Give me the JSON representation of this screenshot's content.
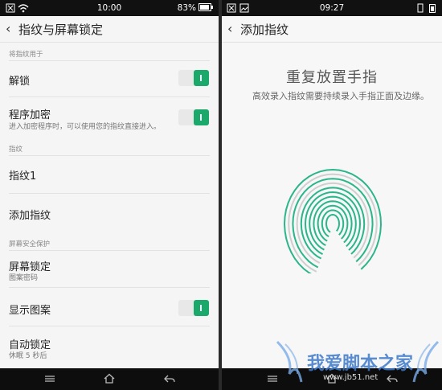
{
  "left": {
    "status": {
      "time": "10:00",
      "battery": "83%"
    },
    "header": {
      "back_icon": "‹",
      "title": "指纹与屏幕锁定"
    },
    "section_fingerprint_use": "将指纹用于",
    "unlock": {
      "label": "解锁",
      "enabled": true
    },
    "app_encrypt": {
      "label": "程序加密",
      "sub": "进入加密程序时，可以使用您的指纹直接进入。",
      "enabled": true
    },
    "section_fingerprint": "指纹",
    "fingerprint_1": {
      "label": "指纹1"
    },
    "add_fingerprint": {
      "label": "添加指纹"
    },
    "section_screen_security": "屏幕安全保护",
    "screen_lock": {
      "label": "屏幕锁定",
      "sub": "图案密码"
    },
    "show_pattern": {
      "label": "显示图案",
      "enabled": true
    },
    "auto_lock": {
      "label": "自动锁定",
      "sub": "休眠 5 秒后"
    }
  },
  "right": {
    "status": {
      "time": "09:27"
    },
    "header": {
      "back_icon": "‹",
      "title": "添加指纹"
    },
    "instruction_title": "重复放置手指",
    "instruction_sub": "高效录入指纹需要持续录入手指正面及边缘。",
    "fingerprint_colors": {
      "done": "#2bb58a",
      "pending": "#cfcfcf"
    }
  },
  "watermark": {
    "text": "我爱脚本之家",
    "url": "www.jb51.net"
  },
  "nav_icons": [
    "menu-icon",
    "home-icon",
    "back-icon"
  ]
}
